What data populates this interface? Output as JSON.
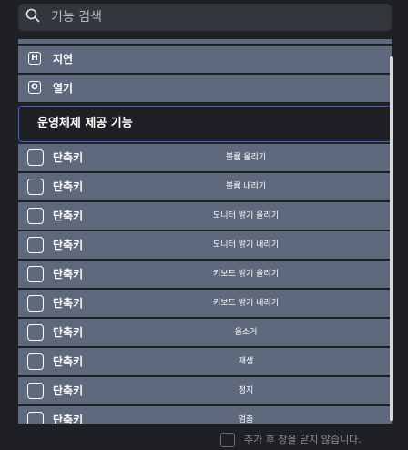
{
  "search": {
    "placeholder": "기능 검색",
    "icon": "search-icon"
  },
  "items": [
    {
      "key": "H",
      "label": "지연"
    },
    {
      "key": "O",
      "label": "열기"
    }
  ],
  "section": {
    "title": "운영체제 제공 기능"
  },
  "shortcuts": [
    {
      "label": "단축키",
      "action": "볼륨 올리기"
    },
    {
      "label": "단축키",
      "action": "볼륨 내리기"
    },
    {
      "label": "단축키",
      "action": "모니터 밝기 올리기"
    },
    {
      "label": "단축키",
      "action": "모니터 밝기 내리기"
    },
    {
      "label": "단축키",
      "action": "키보드 밝기 올리기"
    },
    {
      "label": "단축키",
      "action": "키보드 밝기 내리기"
    },
    {
      "label": "단축키",
      "action": "음소거"
    },
    {
      "label": "단축키",
      "action": "재생"
    },
    {
      "label": "단축키",
      "action": "정지"
    },
    {
      "label": "단축키",
      "action": "멈춤"
    }
  ],
  "footer": {
    "label": "추가 후 창을 닫지 않습니다."
  },
  "colors": {
    "row": "#5f697d",
    "background": "#1f2024",
    "accent": "#3b69d6"
  }
}
